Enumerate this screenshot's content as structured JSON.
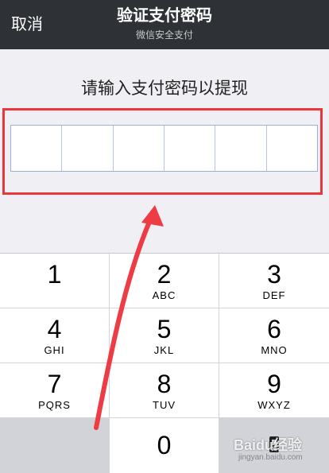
{
  "nav": {
    "cancel_label": "取消",
    "title": "验证支付密码",
    "subtitle": "微信安全支付"
  },
  "prompt": "请输入支付密码以提现",
  "pin": {
    "length": 6
  },
  "keypad": {
    "keys": [
      {
        "digit": "1",
        "letters": ""
      },
      {
        "digit": "2",
        "letters": "ABC"
      },
      {
        "digit": "3",
        "letters": "DEF"
      },
      {
        "digit": "4",
        "letters": "GHI"
      },
      {
        "digit": "5",
        "letters": "JKL"
      },
      {
        "digit": "6",
        "letters": "MNO"
      },
      {
        "digit": "7",
        "letters": "PQRS"
      },
      {
        "digit": "8",
        "letters": "TUV"
      },
      {
        "digit": "9",
        "letters": "WXYZ"
      },
      {
        "digit": "0",
        "letters": ""
      }
    ],
    "backspace_icon": "backspace-icon"
  },
  "watermark": {
    "brand": "Baidu经验",
    "url": "jingyan.baidu.com"
  },
  "colors": {
    "nav_bg": "#2e3135",
    "annotation_red": "#e8383d",
    "pin_border": "#9aaed8"
  }
}
